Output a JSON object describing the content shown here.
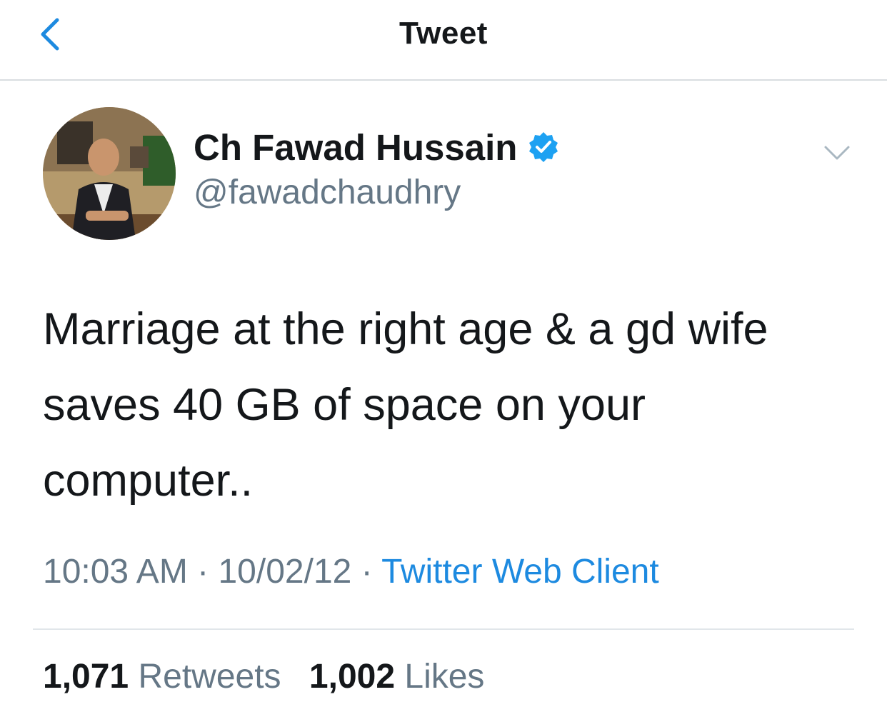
{
  "nav": {
    "title": "Tweet",
    "back_icon": "chevron-left-icon"
  },
  "author": {
    "name": "Ch Fawad Hussain",
    "handle": "@fawadchaudhry",
    "verified": true,
    "verified_icon": "verified-badge-icon"
  },
  "tweet": {
    "line1": "Marriage at the right age & a gd wife",
    "line2": "saves 40 GB of space on your",
    "line3": "computer..",
    "time": "10:03 AM",
    "date": "10/02/12",
    "separator": "·",
    "source": "Twitter Web Client"
  },
  "stats": {
    "retweets_count": "1,071",
    "retweets_label": "Retweets",
    "likes_count": "1,002",
    "likes_label": "Likes"
  },
  "colors": {
    "accent": "#1d8ae0",
    "verified": "#1da1f2",
    "secondary_text": "#657786",
    "primary_text": "#14171a",
    "divider": "#e1e6ea"
  }
}
